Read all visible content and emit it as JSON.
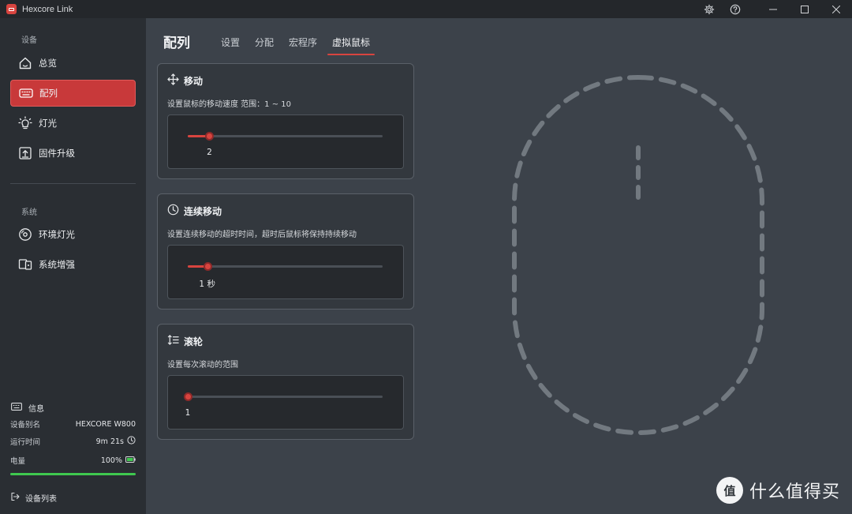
{
  "titlebar": {
    "app_name": "Hexcore Link"
  },
  "sidebar": {
    "section_device": "设备",
    "items": [
      {
        "label": "总览",
        "icon": "home-icon"
      },
      {
        "label": "配列",
        "icon": "keyboard-icon",
        "active": true
      },
      {
        "label": "灯光",
        "icon": "bulb-icon"
      },
      {
        "label": "固件升级",
        "icon": "upload-icon"
      }
    ],
    "section_system": "系统",
    "system_items": [
      {
        "label": "环境灯光",
        "icon": "disc-icon"
      },
      {
        "label": "系统增强",
        "icon": "devices-icon"
      }
    ],
    "info": {
      "title": "信息",
      "device_alias_label": "设备别名",
      "device_alias_value": "HEXCORE W800",
      "uptime_label": "运行时间",
      "uptime_value": "9m 21s",
      "battery_label": "电量",
      "battery_value": "100%",
      "battery_level": 100
    },
    "device_list": "设备列表"
  },
  "header": {
    "title": "配列",
    "tabs": [
      "设置",
      "分配",
      "宏程序",
      "虚拟鼠标"
    ],
    "active_tab": 3
  },
  "cards": [
    {
      "icon": "move-icon",
      "title": "移动",
      "desc": "设置鼠标的移动速度 范围：1 ~ 10",
      "value_text": "2",
      "value": 2,
      "min": 1,
      "max": 10
    },
    {
      "icon": "clock-icon",
      "title": "连续移动",
      "desc": "设置连续移动的超时时间，超时后鼠标将保持持续移动",
      "value_text": "1 秒",
      "value": 1,
      "min": 0,
      "max": 10
    },
    {
      "icon": "scroll-icon",
      "title": "滚轮",
      "desc": "设置每次滚动的范围",
      "value_text": "1",
      "value": 1,
      "min": 1,
      "max": 10
    }
  ],
  "watermark": {
    "badge": "值",
    "text": "什么值得买"
  },
  "colors": {
    "accent": "#d8443f",
    "battery": "#3fc84f",
    "sidebar": "#2a2e33",
    "content": "#3c424a"
  }
}
